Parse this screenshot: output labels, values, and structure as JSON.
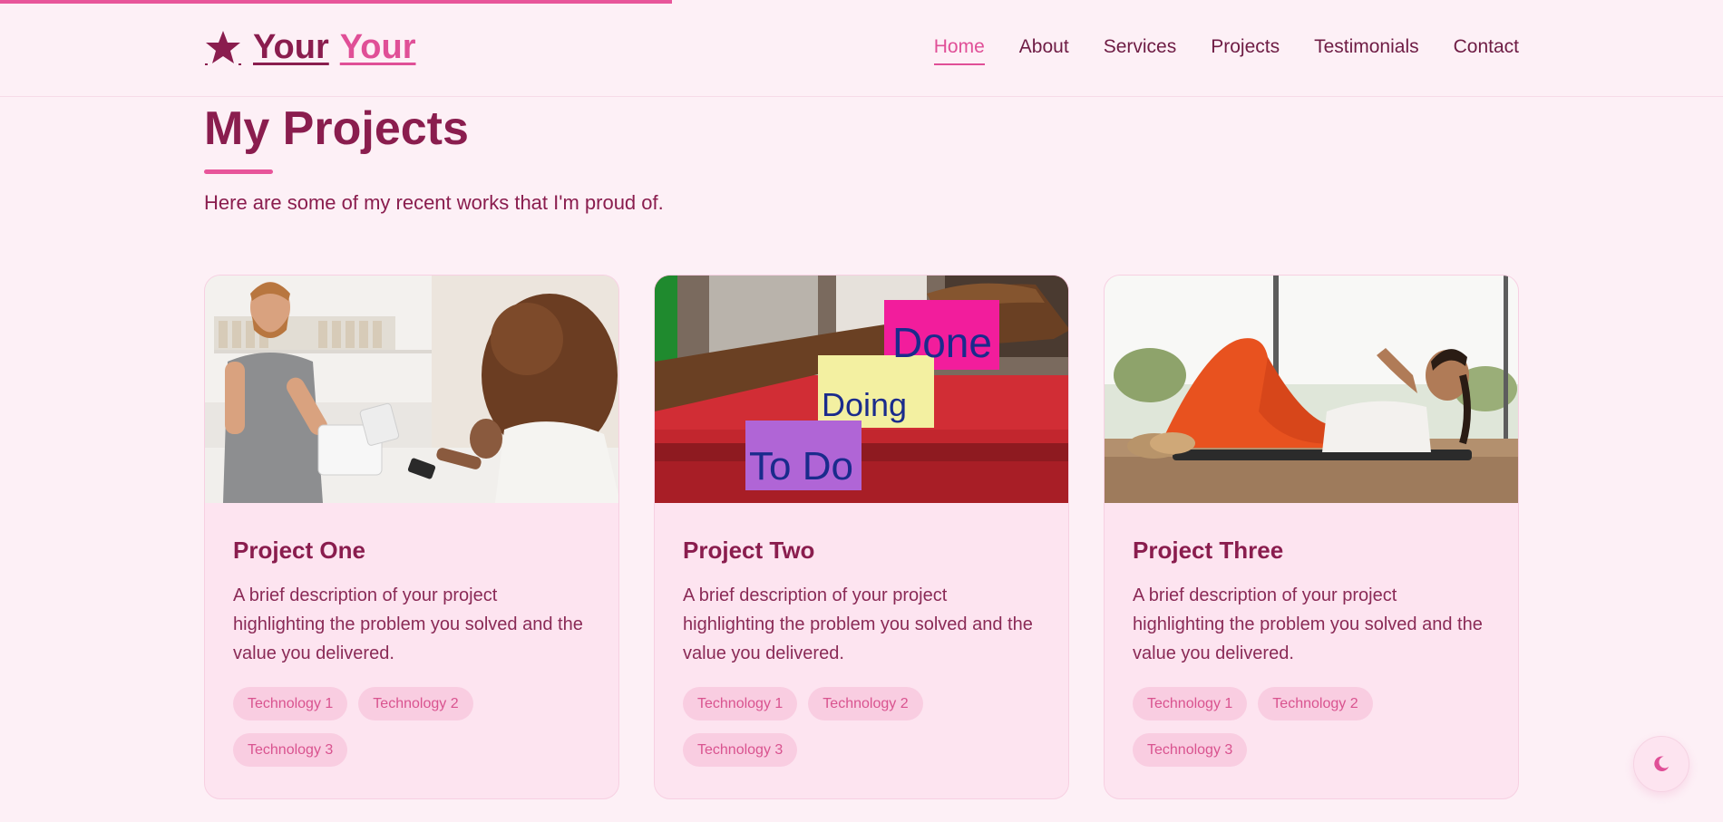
{
  "brand": {
    "icon": "star-icon",
    "word_one": "Your",
    "word_two": "Your",
    "color_dark": "#8a1d4e",
    "color_accent": "#e04f97"
  },
  "scroll_progress": 0.39,
  "nav": {
    "items": [
      {
        "label": "Home",
        "active": true
      },
      {
        "label": "About",
        "active": false
      },
      {
        "label": "Services",
        "active": false
      },
      {
        "label": "Projects",
        "active": false
      },
      {
        "label": "Testimonials",
        "active": false
      },
      {
        "label": "Contact",
        "active": false
      }
    ]
  },
  "section": {
    "title": "My Projects",
    "subtitle": "Here are some of my recent works that I'm proud of."
  },
  "projects": [
    {
      "title": "Project One",
      "image": "photo-checkout-counter",
      "description": "A brief description of your project highlighting the problem you solved and the value you delivered.",
      "tags": [
        "Technology 1",
        "Technology 2",
        "Technology 3"
      ]
    },
    {
      "title": "Project Two",
      "image": "photo-sticky-notes-todo-doing-done",
      "image_text": {
        "note_1": "To Do",
        "note_2": "Doing",
        "note_3": "Done"
      },
      "description": "A brief description of your project highlighting the problem you solved and the value you delivered.",
      "tags": [
        "Technology 1",
        "Technology 2",
        "Technology 3"
      ]
    },
    {
      "title": "Project Three",
      "image": "photo-woman-exercising",
      "description": "A brief description of your project highlighting the problem you solved and the value you delivered.",
      "tags": [
        "Technology 1",
        "Technology 2",
        "Technology 3"
      ]
    }
  ],
  "theme_toggle": {
    "icon": "moon-icon"
  },
  "colors": {
    "background": "#fdf0f6",
    "card": "#fde4f0",
    "tag_bg": "#f9cde1",
    "tag_text": "#d9538f",
    "accent": "#e8559a"
  }
}
